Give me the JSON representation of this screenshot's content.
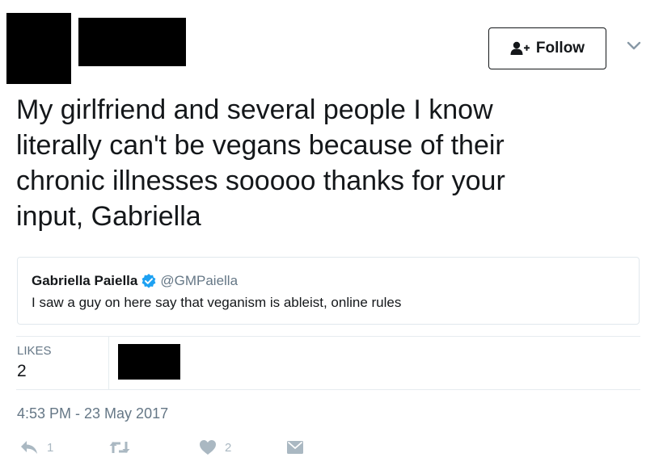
{
  "header": {
    "follow_label": "Follow"
  },
  "tweet": {
    "text": "My girlfriend and several people I know\nliterally can't be vegans because of their\nchronic illnesses sooooo thanks for your\ninput, Gabriella"
  },
  "quoted_tweet": {
    "name": "Gabriella Paiella",
    "handle": "@GMPaiella",
    "text": "I saw a guy on here say that veganism is ableist, online rules"
  },
  "stats": {
    "likes_label": "LIKES",
    "likes_count": "2"
  },
  "timestamp": "4:53 PM - 23 May 2017",
  "actions": {
    "reply_count": "1",
    "like_count": "2"
  },
  "colors": {
    "muted": "#657786",
    "icon": "#aab8c2",
    "verified": "#1da1f2",
    "border": "#e1e8ed"
  },
  "icons": [
    "add-user-icon",
    "chevron-down-icon",
    "verified-badge-icon",
    "reply-icon",
    "retweet-icon",
    "heart-icon",
    "direct-message-icon"
  ]
}
